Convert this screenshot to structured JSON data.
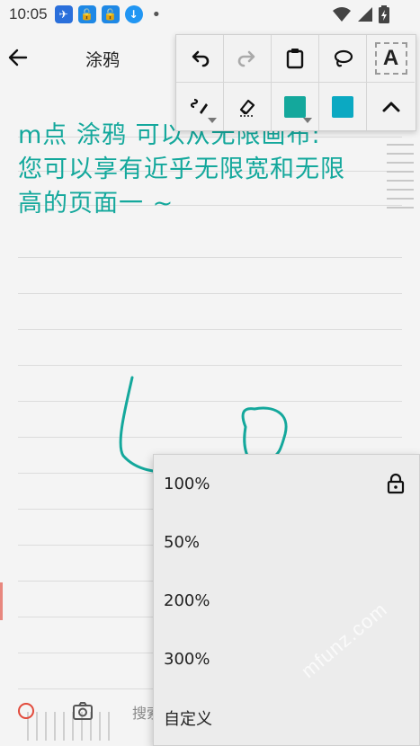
{
  "status_bar": {
    "time": "10:05",
    "notification_icons": [
      "feishu-icon",
      "lock-app-icon",
      "lock-app-icon",
      "download-icon"
    ],
    "signal_icons": [
      "wifi-icon",
      "cellular-icon",
      "battery-icon"
    ]
  },
  "app_bar": {
    "back_icon": "arrow-left-icon",
    "title": "涂鸦"
  },
  "toolbar": {
    "row1": [
      "undo-icon",
      "redo-icon",
      "clipboard-icon",
      "lasso-icon",
      "text-box-icon"
    ],
    "text_tool_label": "A",
    "row2": [
      "pen-style-icon",
      "eraser-icon",
      "color-picker-icon",
      "color-swatch-icon",
      "collapse-up-icon"
    ],
    "colors": {
      "primary": "#14a89c",
      "secondary": "#0ba9c2"
    }
  },
  "canvas": {
    "handwriting_lines": [
      "m点 涂鸦 可以从无限画布:",
      "您可以享有近乎无限宽和无限",
      "高的页面一 ~"
    ],
    "search_hint": "搜索"
  },
  "zoom_menu": {
    "options": [
      "100%",
      "50%",
      "200%",
      "300%",
      "自定义"
    ],
    "lock_icon": "lock-icon"
  },
  "watermark": "mfunz.com"
}
